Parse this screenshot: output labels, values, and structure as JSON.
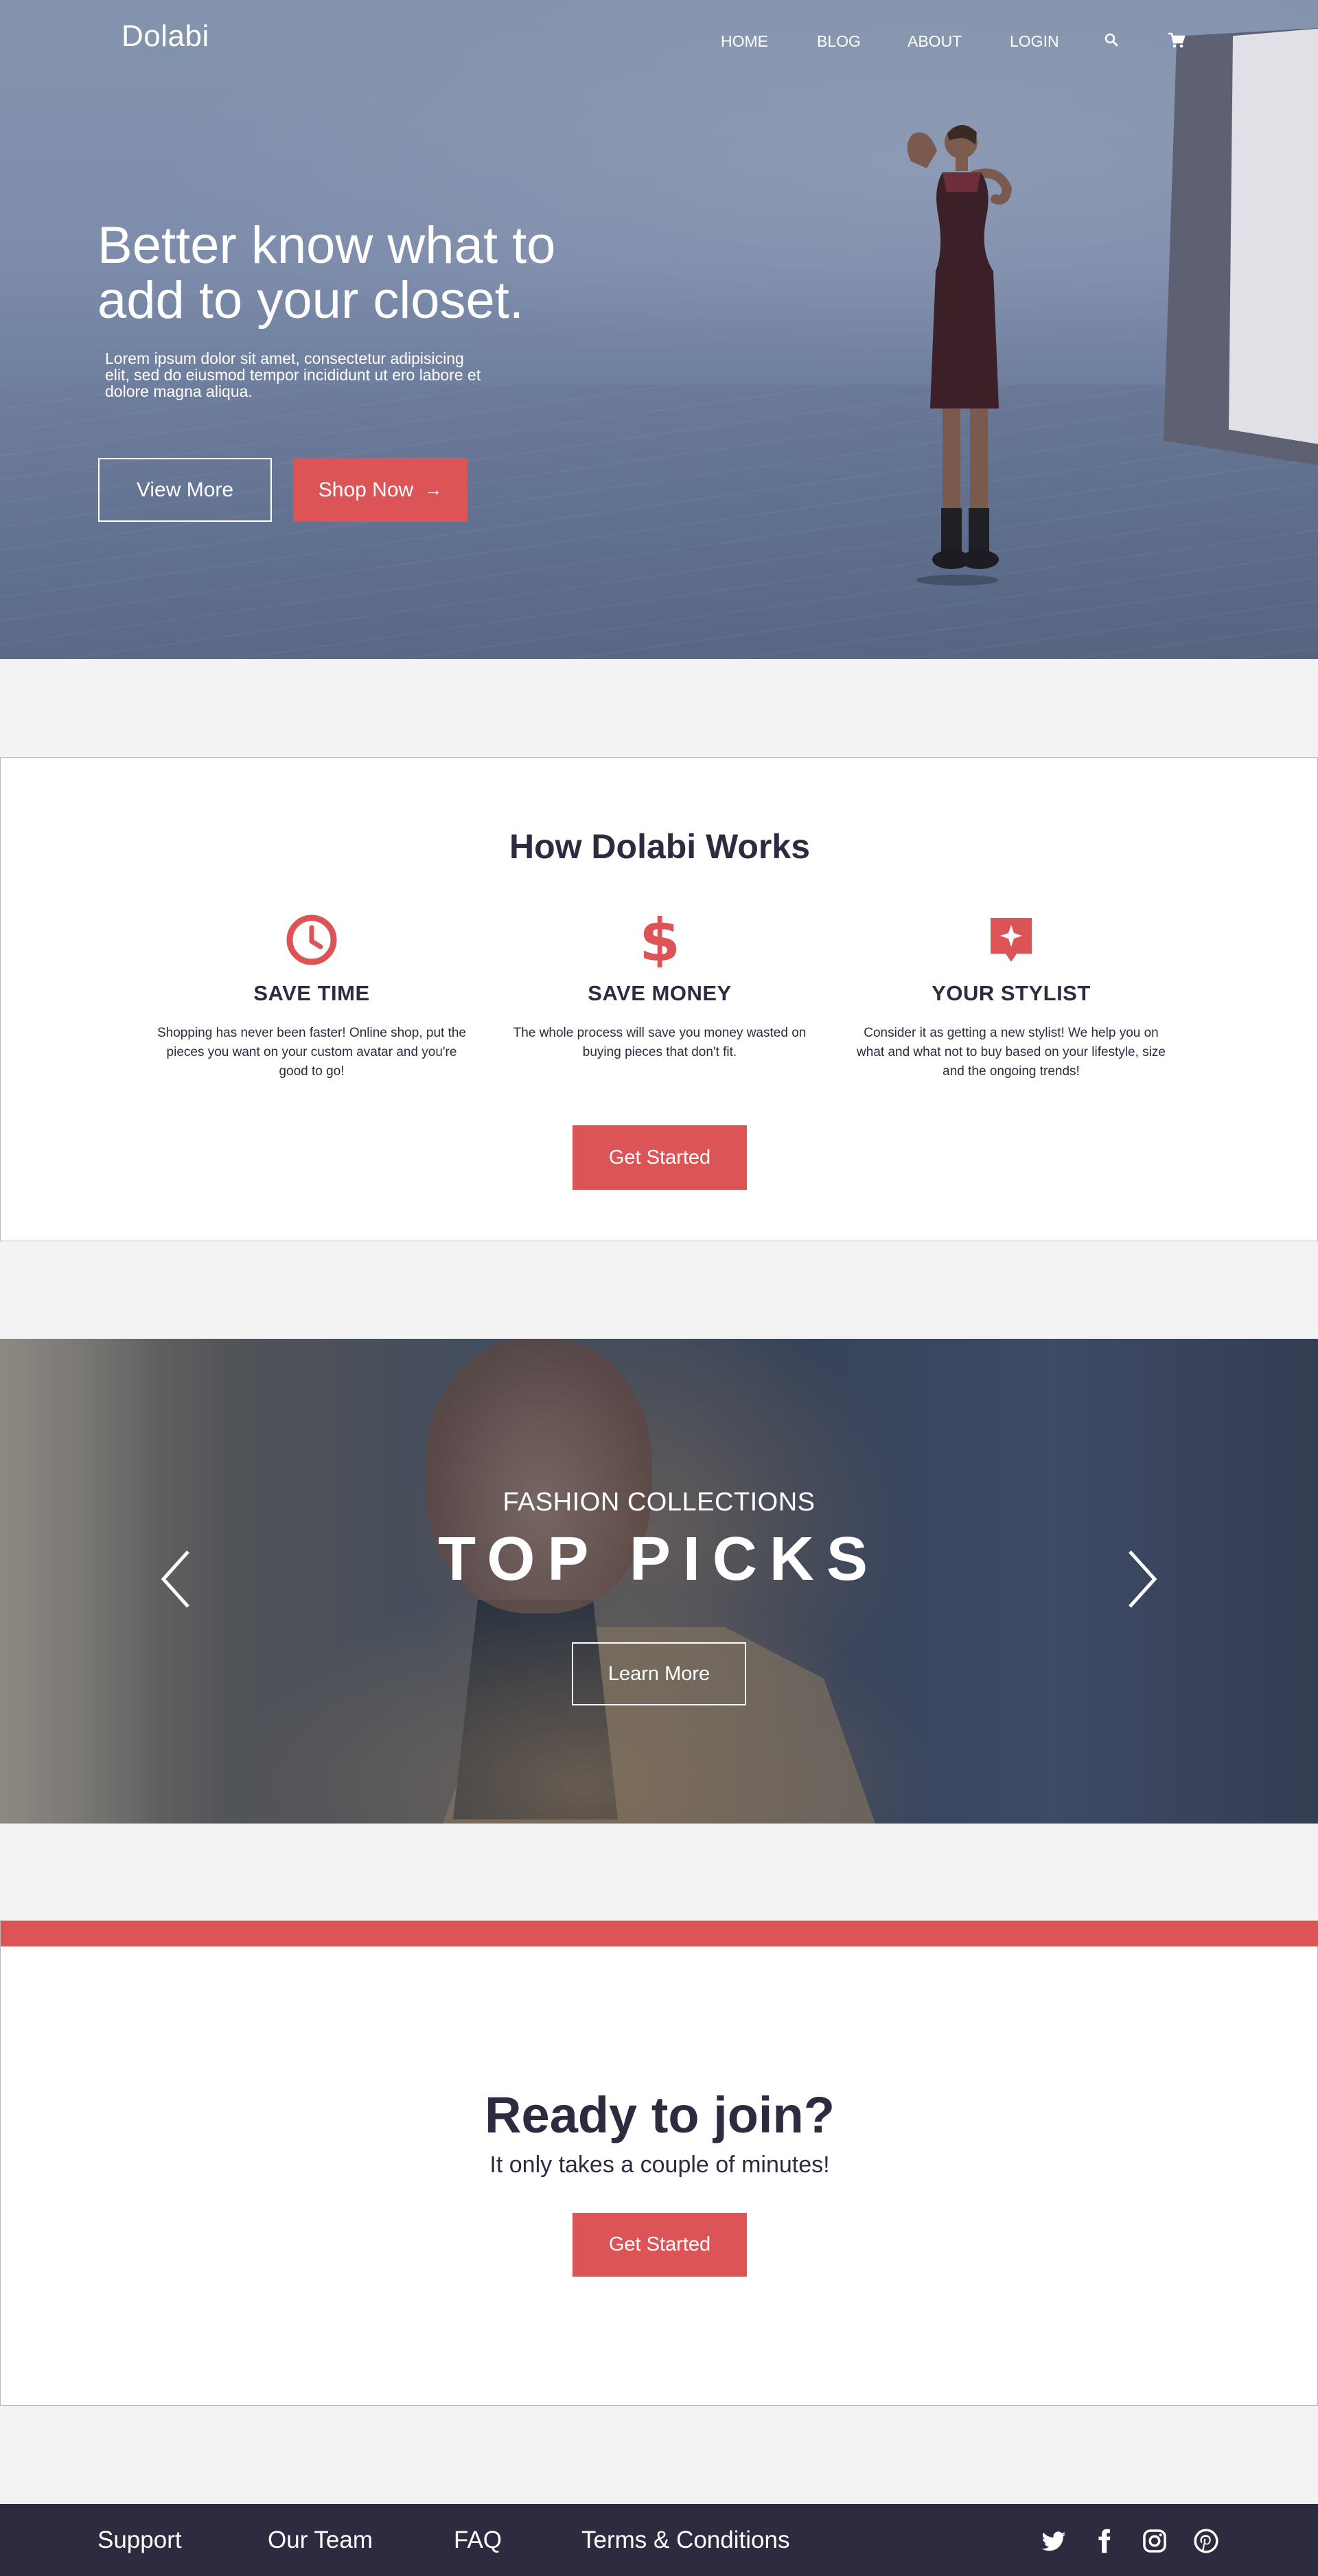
{
  "nav": {
    "brand": "Dolabi",
    "links": [
      "HOME",
      "BLOG",
      "ABOUT",
      "LOGIN"
    ],
    "icons": [
      "search-icon",
      "cart-icon"
    ]
  },
  "hero": {
    "title": "Better know what to add to your closet.",
    "subtitle": "Lorem ipsum dolor sit amet, consectetur adipisicing elit, sed do eiusmod tempor incididunt ut ero labore et dolore magna aliqua.",
    "view_more": "View More",
    "shop_now": "Shop Now",
    "shop_arrow": "→"
  },
  "how": {
    "title": "How Dolabi Works",
    "features": [
      {
        "icon": "clock-icon",
        "title": "SAVE TIME",
        "text": "Shopping has never been faster! Online shop, put the pieces you want on your custom avatar and you're good to go!"
      },
      {
        "icon": "dollar-icon",
        "title": "SAVE MONEY",
        "text": "The whole process will save you money wasted on buying pieces that don't fit."
      },
      {
        "icon": "stylist-icon",
        "title": "YOUR STYLIST",
        "text": "Consider it as getting a new stylist! We help you on what and what not to buy based on your lifestyle, size and the ongoing trends!"
      }
    ],
    "cta": "Get Started"
  },
  "picks": {
    "subtitle": "FASHION COLLECTIONS",
    "title": "TOP PICKS",
    "button": "Learn More"
  },
  "join": {
    "title": "Ready to join?",
    "subtitle": "It only takes a couple of minutes!",
    "cta": "Get Started"
  },
  "footer": {
    "links": [
      "Support",
      "Our Team",
      "FAQ",
      "Terms & Conditions"
    ],
    "social": [
      "twitter-icon",
      "facebook-icon",
      "instagram-icon",
      "pinterest-icon"
    ]
  },
  "colors": {
    "accent": "#dc5456",
    "dark": "#2c2b40",
    "background": "#f3f3f3"
  }
}
